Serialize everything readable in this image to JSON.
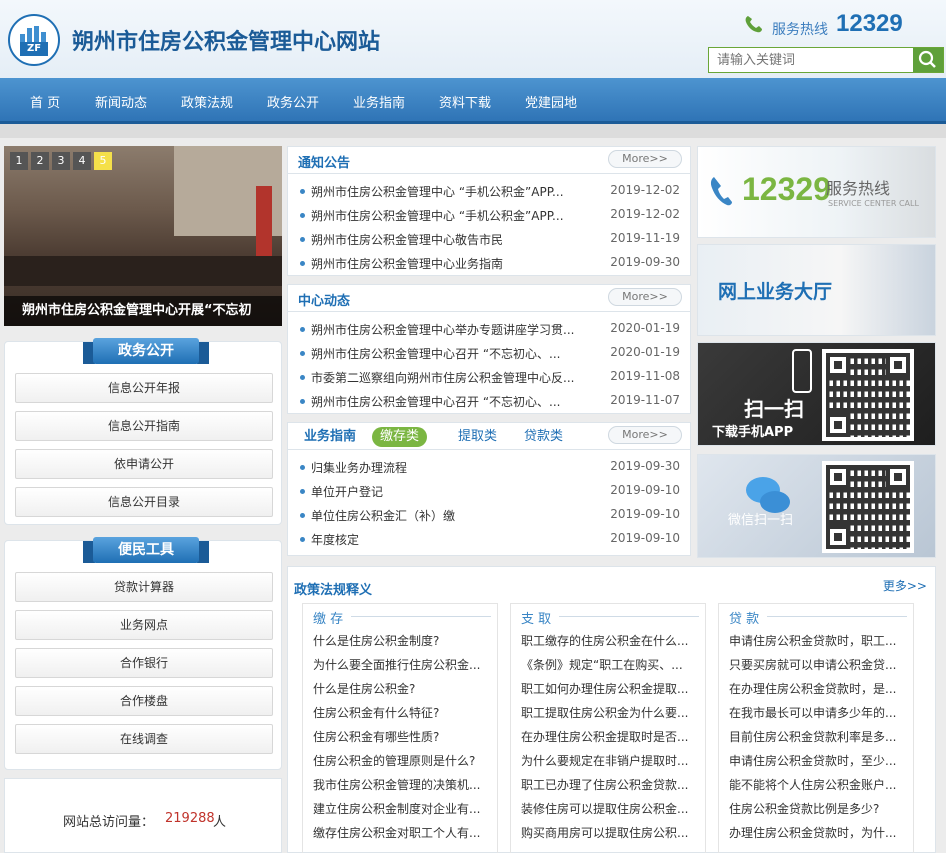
{
  "header": {
    "site_title": "朔州市住房公积金管理中心网站",
    "hotline_label": "服务热线",
    "hotline_number": "12329",
    "search_placeholder": "请输入关键词"
  },
  "nav": [
    "首 页",
    "新闻动态",
    "政策法规",
    "政务公开",
    "业务指南",
    "资料下载",
    "党建园地"
  ],
  "slider": {
    "pages": [
      "1",
      "2",
      "3",
      "4",
      "5"
    ],
    "active_page": "5",
    "caption": "朔州市住房公积金管理中心开展“不忘初"
  },
  "gov_open": {
    "title": "政务公开",
    "items": [
      "信息公开年报",
      "信息公开指南",
      "依申请公开",
      "信息公开目录"
    ]
  },
  "tools": {
    "title": "便民工具",
    "items": [
      "贷款计算器",
      "业务网点",
      "合作银行",
      "合作楼盘",
      "在线调查"
    ]
  },
  "counter": {
    "label": "网站总访问量：",
    "value": "219288",
    "unit": "人"
  },
  "notices": {
    "title": "通知公告",
    "more": "More>>",
    "items": [
      {
        "title": "朔州市住房公积金管理中心 “手机公积金”APP...",
        "date": "2019-12-02"
      },
      {
        "title": "朔州市住房公积金管理中心 “手机公积金”APP...",
        "date": "2019-12-02"
      },
      {
        "title": "朔州市住房公积金管理中心敬告市民",
        "date": "2019-11-19"
      },
      {
        "title": "朔州市住房公积金管理中心业务指南",
        "date": "2019-09-30"
      }
    ]
  },
  "news": {
    "title": "中心动态",
    "more": "More>>",
    "items": [
      {
        "title": "朔州市住房公积金管理中心举办专题讲座学习贯...",
        "date": "2020-01-19"
      },
      {
        "title": "朔州市住房公积金管理中心召开 “不忘初心、...",
        "date": "2020-01-19"
      },
      {
        "title": "市委第二巡察组向朔州市住房公积金管理中心反...",
        "date": "2019-11-08"
      },
      {
        "title": "朔州市住房公积金管理中心召开 “不忘初心、...",
        "date": "2019-11-07"
      }
    ]
  },
  "guide": {
    "title": "业务指南",
    "tabs": [
      "缴存类",
      "提取类",
      "贷款类"
    ],
    "more": "More>>",
    "items": [
      {
        "title": "归集业务办理流程",
        "date": "2019-09-30"
      },
      {
        "title": "单位开户登记",
        "date": "2019-09-10"
      },
      {
        "title": "单位住房公积金汇（补）缴",
        "date": "2019-09-10"
      },
      {
        "title": "年度核定",
        "date": "2019-09-10"
      }
    ]
  },
  "ads": {
    "hotline_number": "12329",
    "hotline_cn": "服务热线",
    "hotline_en": "SERVICE CENTER CALL",
    "online_hall": "网上业务大厅",
    "scan_title": "扫一扫",
    "scan_sub": "下载手机APP",
    "wechat": "微信扫一扫"
  },
  "policy": {
    "title": "政策法规释义",
    "more": "更多>>",
    "columns": [
      {
        "head": "缴 存",
        "items": [
          "什么是住房公积金制度?",
          "为什么要全面推行住房公积金...",
          "什么是住房公积金?",
          "住房公积金有什么特征?",
          "住房公积金有哪些性质?",
          "住房公积金的管理原则是什么?",
          "我市住房公积金管理的决策机...",
          "建立住房公积金制度对企业有...",
          "缴存住房公积金对职工个人有..."
        ]
      },
      {
        "head": "支 取",
        "items": [
          "职工缴存的住房公积金在什么...",
          "《条例》规定“职工在购买、...",
          "职工如何办理住房公积金提取...",
          "职工提取住房公积金为什么要...",
          "在办理住房公积金提取时是否...",
          "为什么要规定在非销户提取时...",
          "职工已办理了住房公积金贷款...",
          "装修住房可以提取住房公积金...",
          "购买商用房可以提取住房公积..."
        ]
      },
      {
        "head": "贷 款",
        "items": [
          "申请住房公积金贷款时，职工...",
          "只要买房就可以申请公积金贷...",
          "在办理住房公积金贷款时，是...",
          "在我市最长可以申请多少年的...",
          "目前住房公积金贷款利率是多...",
          "申请住房公积金贷款时，至少...",
          "能不能将个人住房公积金账户...",
          "住房公积金贷款比例是多少?",
          "办理住房公积金贷款时，为什..."
        ]
      }
    ]
  }
}
